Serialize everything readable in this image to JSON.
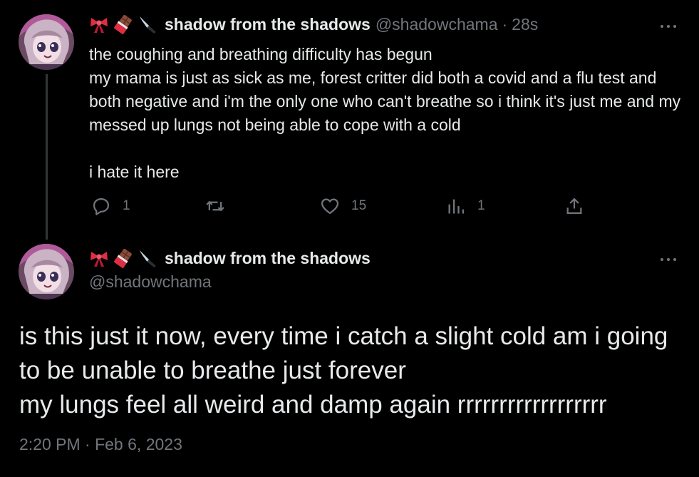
{
  "reply_tweet": {
    "author": {
      "emoji": [
        "bow-emoji",
        "chocolate-bar-emoji",
        "kitchen-knife-emoji"
      ],
      "display_name": "shadow from the shadows",
      "handle": "@shadowchama",
      "separator": "·",
      "time_ago": "28s"
    },
    "text": "the coughing and breathing difficulty has begun\nmy mama is just as sick as me, forest critter did both a covid and a flu test and both negative and i'm the only one who can't breathe so i think it's just me and my messed up lungs not being able to cope with a cold\n\ni hate it here",
    "actions": {
      "reply_count": "1",
      "repost_count": "",
      "like_count": "15",
      "view_count": "1"
    }
  },
  "main_tweet": {
    "author": {
      "emoji": [
        "bow-emoji",
        "chocolate-bar-emoji",
        "kitchen-knife-emoji"
      ],
      "display_name": "shadow from the shadows",
      "handle": "@shadowchama"
    },
    "text": "is this just it now, every time i catch a slight cold am i going to be unable to breathe just forever\nmy lungs feel all weird and damp again rrrrrrrrrrrrrrrrrr",
    "timestamp": "2:20 PM · Feb 6, 2023"
  },
  "colors": {
    "background": "#000000",
    "text_primary": "#e7e9ea",
    "text_secondary": "#71767b",
    "thread_line": "#333639"
  }
}
